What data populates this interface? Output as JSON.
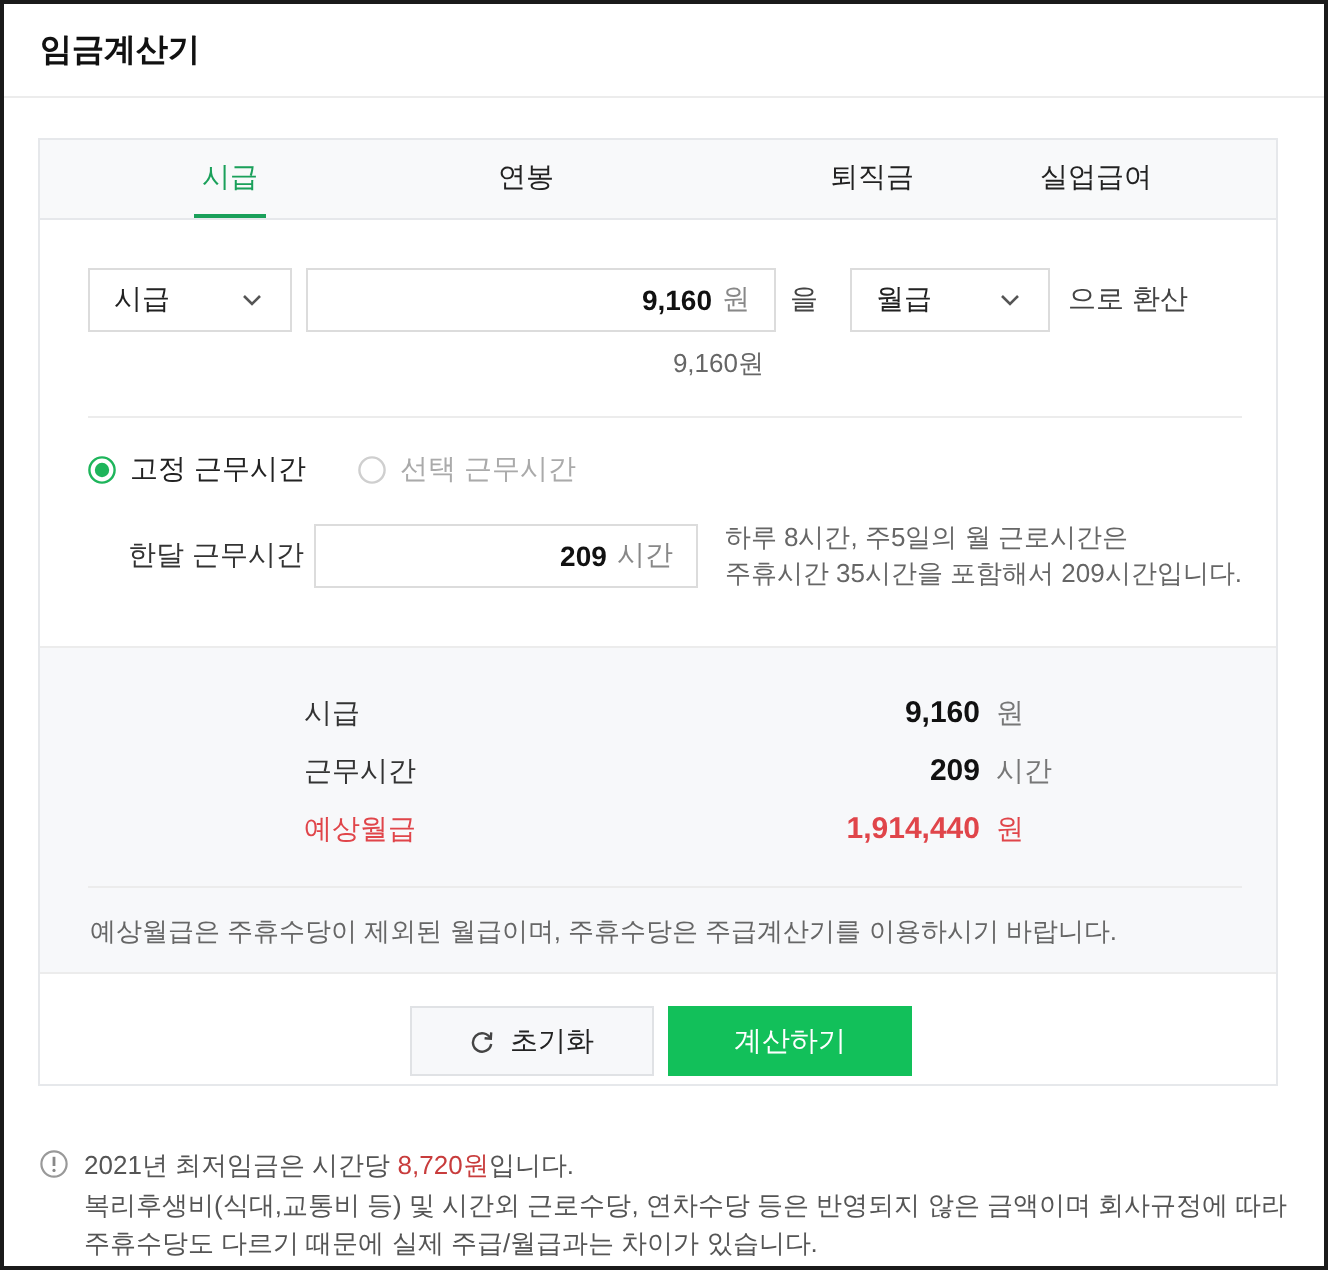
{
  "title": "임금계산기",
  "tabs": [
    {
      "label": "시급",
      "selected": true
    },
    {
      "label": "연봉",
      "selected": false
    },
    {
      "label": "퇴직금",
      "selected": false
    },
    {
      "label": "실업급여",
      "selected": false
    }
  ],
  "converter": {
    "from_select": "시급",
    "amount": "9,160",
    "amount_unit": "원",
    "particle": "을",
    "to_select": "월급",
    "suffix": "으로 환산",
    "amount_hint": "9,160원"
  },
  "work_time_modes": [
    {
      "label": "고정 근무시간",
      "selected": true
    },
    {
      "label": "선택 근무시간",
      "selected": false
    }
  ],
  "monthly_hours": {
    "label": "한달 근무시간",
    "value": "209",
    "unit": "시간",
    "description_lines": [
      "하루 8시간, 주5일의 월 근로시간은",
      "주휴시간 35시간을 포함해서 209시간입니다."
    ]
  },
  "results": [
    {
      "label": "시급",
      "value": "9,160",
      "unit": "원",
      "highlight": false
    },
    {
      "label": "근무시간",
      "value": "209",
      "unit": "시간",
      "highlight": false
    },
    {
      "label": "예상월급",
      "value": "1,914,440",
      "unit": "원",
      "highlight": true
    }
  ],
  "results_note": "예상월급은 주휴수당이 제외된 월급이며, 주휴수당은 주급계산기를 이용하시기 바랍니다.",
  "buttons": [
    {
      "kind": "reset",
      "label": "초기화"
    },
    {
      "kind": "primary",
      "label": "계산하기"
    }
  ],
  "notice": {
    "parts": [
      {
        "text": "2021년 최저임금은 시간당 ",
        "emphasis": false
      },
      {
        "text": "8,720원",
        "emphasis": true
      },
      {
        "text": "입니다.",
        "emphasis": false
      }
    ],
    "disclaimer": "복리후생비(식대,교통비 등) 및 시간외 근로수당, 연차수당 등은 반영되지 않은 금액이며 회사규정에 따라 주휴수당도 다르기 때문에 실제 주급/월급과는 차이가 있습니다."
  }
}
